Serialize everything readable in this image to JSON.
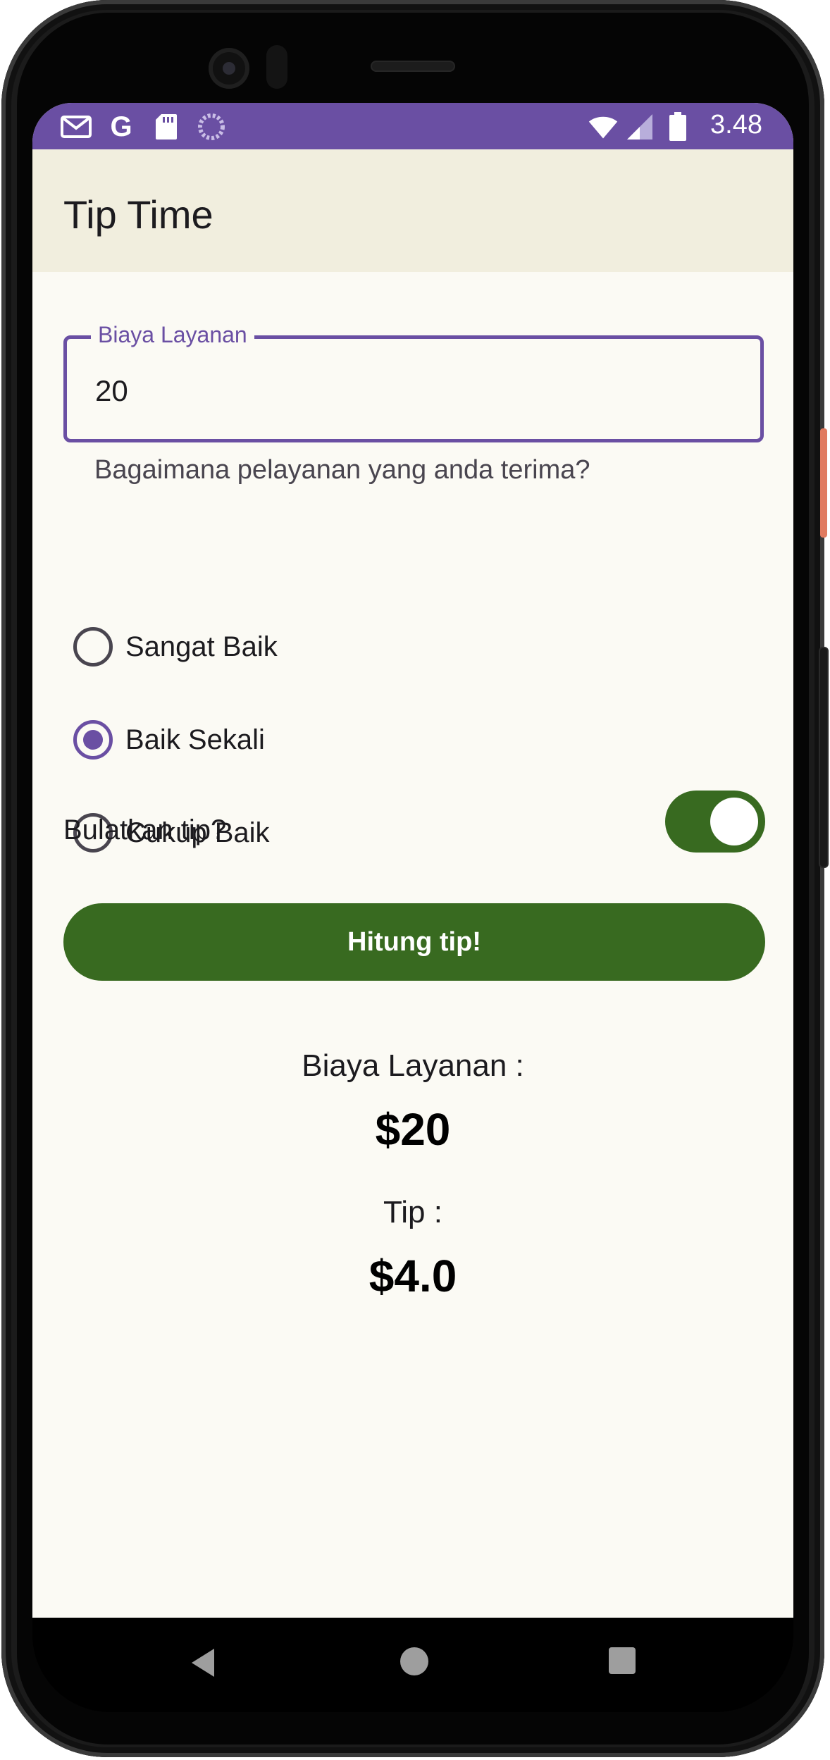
{
  "status_bar": {
    "icons_left": [
      "gmail-icon",
      "google-icon",
      "sd-card-icon",
      "loading-icon"
    ],
    "icons_right": [
      "wifi-icon",
      "signal-icon",
      "battery-icon"
    ],
    "time": "3.48"
  },
  "app_bar": {
    "title": "Tip Time"
  },
  "bill_field": {
    "label": "Biaya Layanan",
    "value": "20"
  },
  "service": {
    "question": "Bagaimana pelayanan yang anda terima?",
    "options": [
      {
        "label": "Sangat Baik",
        "selected": false
      },
      {
        "label": "Baik Sekali",
        "selected": true
      },
      {
        "label": "Cukup Baik",
        "selected": false
      }
    ]
  },
  "round_up": {
    "label": "Bulatkan tip?",
    "checked": true
  },
  "calculate_button": {
    "label": "Hitung tip!"
  },
  "results": {
    "bill_label": "Biaya Layanan :",
    "bill_value": "$20",
    "tip_label": "Tip :",
    "tip_value": "$4.0"
  },
  "colors": {
    "primary": "#6a4fa3",
    "green": "#386a20",
    "app_bar_bg": "#f1eede",
    "background": "#fbfaf4"
  }
}
